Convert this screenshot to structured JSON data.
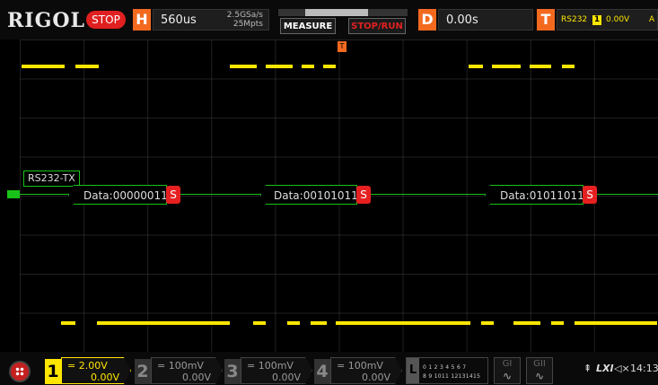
{
  "header": {
    "brand": "RIGOL",
    "run_state": "STOP",
    "horizontal": {
      "key": "H",
      "timebase": "560us",
      "sample_rate": "2.5GSa/s",
      "memory_depth": "25Mpts"
    },
    "measure_button": "MEASURE",
    "stop_run_button": "STOP/RUN",
    "delay": {
      "key": "D",
      "value": "0.00s"
    },
    "trigger": {
      "key": "T",
      "source_type": "RS232",
      "channel": "1",
      "level": "0.00V",
      "mode": "A"
    }
  },
  "waveform": {
    "trigger_marker": "T",
    "bus_name": "RS232-TX",
    "packets": [
      {
        "text": "Data:00000011",
        "tag": "S"
      },
      {
        "text": "Data:00101011",
        "tag": "S"
      },
      {
        "text": "Data:01011011",
        "tag": "S"
      }
    ]
  },
  "channels": [
    {
      "num": "1",
      "coupling": "=",
      "scale": "2.00V",
      "offset": "0.00V",
      "color": "#ffe600",
      "active": true
    },
    {
      "num": "2",
      "coupling": "=",
      "scale": "100mV",
      "offset": "0.00V",
      "color": "#00e5ff",
      "active": false
    },
    {
      "num": "3",
      "coupling": "=",
      "scale": "100mV",
      "offset": "0.00V",
      "color": "#ff40ff",
      "active": false
    },
    {
      "num": "4",
      "coupling": "=",
      "scale": "100mV",
      "offset": "0.00V",
      "color": "#3070ff",
      "active": false
    }
  ],
  "logic": {
    "key": "L",
    "row1": "0 1 2 3  4 5 6 7",
    "row2": "8 9 1011 12131415"
  },
  "generators": [
    {
      "label": "GI",
      "symbol": "∿"
    },
    {
      "label": "GII",
      "symbol": "∿"
    }
  ],
  "status": {
    "usb": "⇞",
    "lxi": "LXI",
    "sound": "◁×",
    "time": "14:13"
  },
  "colors": {
    "accent_orange": "#f36a1f",
    "bus_green": "#19c219",
    "stop_red": "#e02020",
    "ch1_yellow": "#ffe600"
  }
}
